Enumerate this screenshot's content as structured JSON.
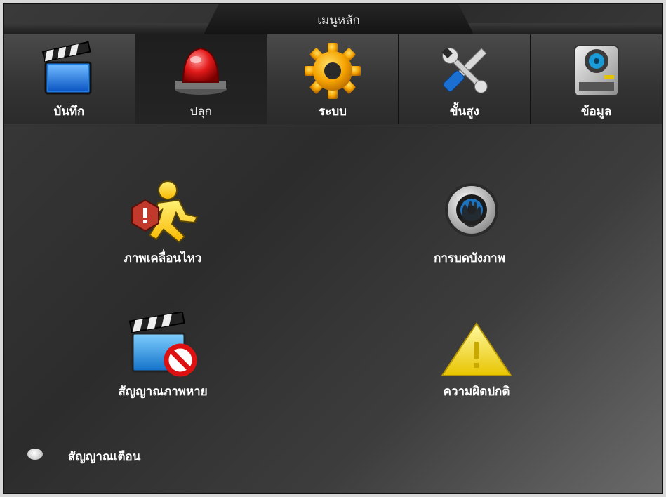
{
  "window": {
    "title": "เมนูหลัก"
  },
  "tabs": [
    {
      "label": "บันทึก",
      "icon": "clapperboard-icon",
      "active": false
    },
    {
      "label": "ปลุก",
      "icon": "siren-icon",
      "active": true
    },
    {
      "label": "ระบบ",
      "icon": "gear-icon",
      "active": false
    },
    {
      "label": "ขั้นสูง",
      "icon": "tools-icon",
      "active": false
    },
    {
      "label": "ข้อมูล",
      "icon": "hard-drive-icon",
      "active": false
    }
  ],
  "items": [
    {
      "label": "ภาพเคลื่อนไหว",
      "icon": "motion-detection-icon"
    },
    {
      "label": "การบดบังภาพ",
      "icon": "video-tampering-icon"
    },
    {
      "label": "สัญญาณภาพหาย",
      "icon": "video-loss-icon"
    },
    {
      "label": "ความผิดปกติ",
      "icon": "warning-triangle-icon"
    }
  ],
  "footer": {
    "option_label": "สัญญาณเตือน",
    "option_selected": false
  },
  "colors": {
    "background": "#333333",
    "text": "#ffffff",
    "active_tab": "#1e1e1e"
  }
}
